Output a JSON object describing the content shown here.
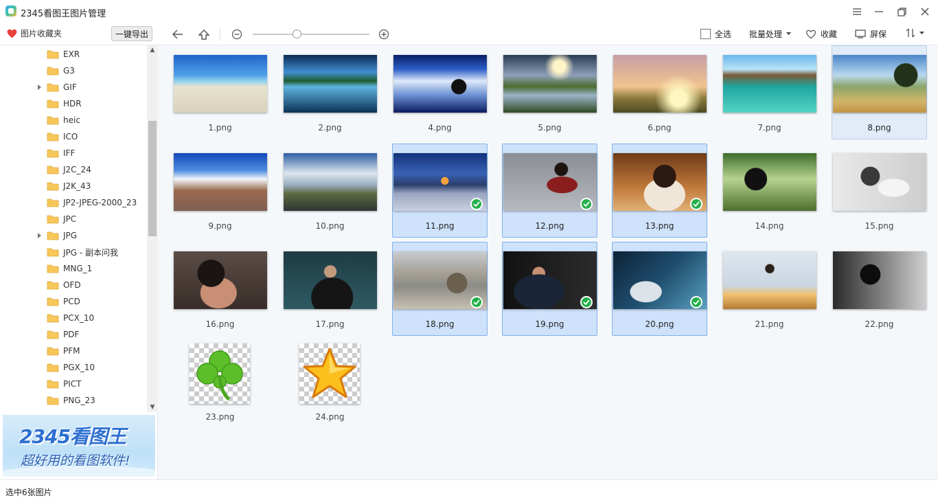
{
  "app": {
    "title": "2345看图王图片管理"
  },
  "window_controls": [
    "menu-icon",
    "minimize-icon",
    "restore-icon",
    "close-icon"
  ],
  "toolbar": {
    "favorites_label": "图片收藏夹",
    "export_label": "一键导出",
    "select_all_label": "全选",
    "batch_label": "批量处理",
    "collect_label": "收藏",
    "screen_label": "屏保",
    "zoom_level": 0.4
  },
  "sidebar": {
    "folders": [
      {
        "name": "EXR",
        "expandable": false
      },
      {
        "name": "G3",
        "expandable": false
      },
      {
        "name": "GIF",
        "expandable": true
      },
      {
        "name": "HDR",
        "expandable": false
      },
      {
        "name": "heic",
        "expandable": false
      },
      {
        "name": "ICO",
        "expandable": false
      },
      {
        "name": "IFF",
        "expandable": false
      },
      {
        "name": "J2C_24",
        "expandable": false
      },
      {
        "name": "J2K_43",
        "expandable": false
      },
      {
        "name": "JP2-JPEG-2000_23",
        "expandable": false
      },
      {
        "name": "JPC",
        "expandable": false
      },
      {
        "name": "JPG",
        "expandable": true
      },
      {
        "name": "JPG - 副本问我",
        "expandable": false
      },
      {
        "name": "MNG_1",
        "expandable": false
      },
      {
        "name": "OFD",
        "expandable": false
      },
      {
        "name": "PCD",
        "expandable": false
      },
      {
        "name": "PCX_10",
        "expandable": false
      },
      {
        "name": "PDF",
        "expandable": false
      },
      {
        "name": "PFM",
        "expandable": false
      },
      {
        "name": "PGX_10",
        "expandable": false
      },
      {
        "name": "PICT",
        "expandable": false
      },
      {
        "name": "PNG_23",
        "expandable": false
      }
    ],
    "banner": {
      "brand": "2345看图王",
      "slogan": "超好用的看图软件!"
    }
  },
  "images": [
    {
      "name": "1.png",
      "art": "art-1",
      "state": "normal"
    },
    {
      "name": "2.png",
      "art": "art-2",
      "state": "normal"
    },
    {
      "name": "4.png",
      "art": "art-4",
      "state": "normal"
    },
    {
      "name": "5.png",
      "art": "art-5",
      "state": "normal"
    },
    {
      "name": "6.png",
      "art": "art-6",
      "state": "normal"
    },
    {
      "name": "7.png",
      "art": "art-7",
      "state": "normal"
    },
    {
      "name": "8.png",
      "art": "art-8",
      "state": "highlighted"
    },
    {
      "name": "9.png",
      "art": "art-9",
      "state": "normal"
    },
    {
      "name": "10.png",
      "art": "art-10",
      "state": "normal"
    },
    {
      "name": "11.png",
      "art": "art-11",
      "state": "selected"
    },
    {
      "name": "12.png",
      "art": "art-12",
      "state": "selected"
    },
    {
      "name": "13.png",
      "art": "art-13",
      "state": "selected"
    },
    {
      "name": "14.png",
      "art": "art-14",
      "state": "normal"
    },
    {
      "name": "15.png",
      "art": "art-15",
      "state": "normal"
    },
    {
      "name": "16.png",
      "art": "art-16",
      "state": "normal"
    },
    {
      "name": "17.png",
      "art": "art-17",
      "state": "normal"
    },
    {
      "name": "18.png",
      "art": "art-18",
      "state": "selected"
    },
    {
      "name": "19.png",
      "art": "art-19",
      "state": "selected"
    },
    {
      "name": "20.png",
      "art": "art-20",
      "state": "selected"
    },
    {
      "name": "21.png",
      "art": "art-21",
      "state": "normal"
    },
    {
      "name": "22.png",
      "art": "art-22",
      "state": "normal"
    },
    {
      "name": "23.png",
      "art": "clover",
      "state": "normal"
    },
    {
      "name": "24.png",
      "art": "star",
      "state": "normal"
    }
  ],
  "status": {
    "text": "选中6张图片"
  },
  "colors": {
    "selection_bg": "#cfe2fb",
    "selection_border": "#7fb1ea",
    "check_green": "#24b04a",
    "folder_yellow": "#f7c75a",
    "heart_red": "#e8403c"
  }
}
